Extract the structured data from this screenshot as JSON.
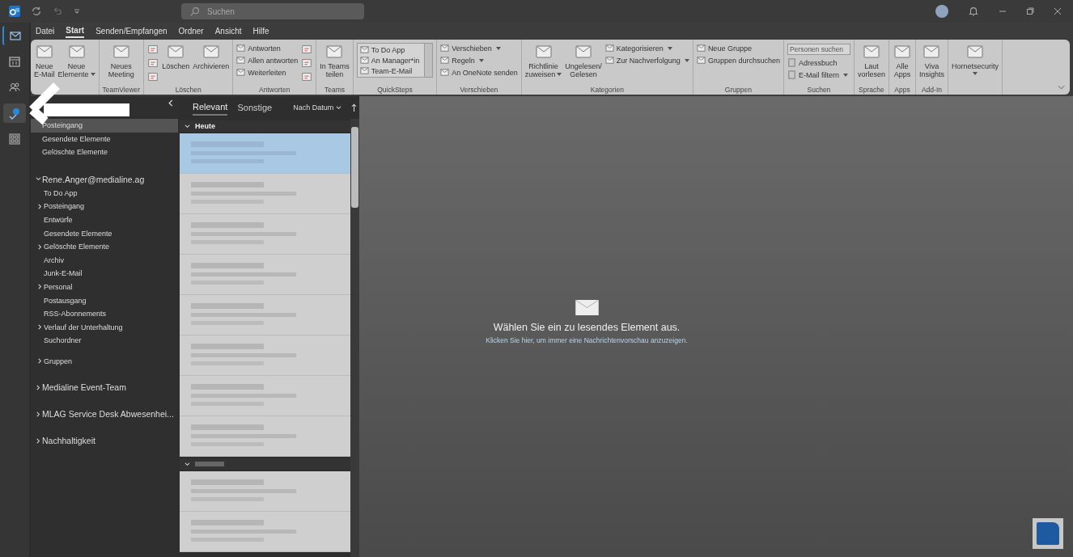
{
  "title_bar": {
    "search": {
      "placeholder": "Suchen"
    }
  },
  "menu_tabs": [
    {
      "label": "Datei",
      "selected": false
    },
    {
      "label": "Start",
      "selected": true
    },
    {
      "label": "Senden/Empfangen",
      "selected": false
    },
    {
      "label": "Ordner",
      "selected": false
    },
    {
      "label": "Ansicht",
      "selected": false
    },
    {
      "label": "Hilfe",
      "selected": false
    }
  ],
  "ribbon": [
    {
      "items": [
        {
          "kind": "large",
          "lines": [
            "Neue",
            "E-Mail"
          ],
          "dropdown": false
        },
        {
          "kind": "large",
          "lines": [
            "Neue",
            "Elemente"
          ],
          "dropdown": true
        }
      ]
    },
    {
      "name": "TeamViewer",
      "items": [
        {
          "kind": "large",
          "lines": [
            "Neues",
            "Meeting"
          ],
          "dropdown": false
        }
      ]
    },
    {
      "name": "Löschen",
      "items": [
        {
          "kind": "icons"
        },
        {
          "kind": "large",
          "lines": [
            "Löschen"
          ],
          "dropdown": false
        },
        {
          "kind": "large",
          "lines": [
            "Archivieren"
          ],
          "dropdown": false
        }
      ]
    },
    {
      "name": "Antworten",
      "items": [
        {
          "kind": "small",
          "entries": [
            {
              "label": "Antworten",
              "dropdown": false
            },
            {
              "label": "Allen antworten",
              "dropdown": false
            },
            {
              "label": "Weiterleiten",
              "dropdown": false
            }
          ]
        },
        {
          "kind": "icons"
        }
      ]
    },
    {
      "name": "Teams",
      "items": [
        {
          "kind": "large",
          "lines": [
            "In Teams",
            "teilen"
          ],
          "dropdown": false
        }
      ]
    },
    {
      "name": "QuickSteps",
      "items": [
        {
          "kind": "gallery",
          "entries": [
            "To Do App",
            "An Manager*in",
            "Team-E-Mail"
          ]
        }
      ]
    },
    {
      "name": "Verschieben",
      "items": [
        {
          "kind": "small",
          "entries": [
            {
              "label": "Verschieben",
              "dropdown": true
            },
            {
              "label": "Regeln",
              "dropdown": true
            },
            {
              "label": "An OneNote senden",
              "dropdown": false
            }
          ]
        }
      ]
    },
    {
      "name": "Kategorien",
      "items": [
        {
          "kind": "large",
          "lines": [
            "Richtlinie",
            "zuweisen"
          ],
          "dropdown": true
        },
        {
          "kind": "large",
          "lines": [
            "Ungelesen/",
            "Gelesen"
          ],
          "dropdown": false
        },
        {
          "kind": "small",
          "entries": [
            {
              "label": "Kategorisieren",
              "dropdown": true
            },
            {
              "label": "Zur Nachverfolgung",
              "dropdown": true
            }
          ]
        }
      ]
    },
    {
      "name": "Gruppen",
      "items": [
        {
          "kind": "small",
          "entries": [
            {
              "label": "Neue Gruppe",
              "dropdown": false
            },
            {
              "label": "Gruppen durchsuchen",
              "dropdown": false
            }
          ]
        }
      ]
    },
    {
      "name": "Suchen",
      "items": [
        {
          "kind": "search",
          "placeholder": "Personen suchen",
          "entries": [
            {
              "label": "Adressbuch",
              "dropdown": false
            },
            {
              "label": "E-Mail filtern",
              "dropdown": true
            }
          ]
        }
      ]
    },
    {
      "name": "Sprache",
      "items": [
        {
          "kind": "large",
          "lines": [
            "Laut",
            "vorlesen"
          ],
          "dropdown": false
        }
      ]
    },
    {
      "name": "Apps",
      "items": [
        {
          "kind": "large",
          "lines": [
            "Alle",
            "Apps"
          ],
          "dropdown": false
        }
      ]
    },
    {
      "name": "Add-In",
      "items": [
        {
          "kind": "large",
          "lines": [
            "Viva",
            "Insights"
          ],
          "dropdown": false
        }
      ]
    },
    {
      "items": [
        {
          "kind": "large",
          "lines": [
            "Hornetsecurity"
          ],
          "dropdown": true
        }
      ]
    }
  ],
  "favorites": [
    {
      "label": "Posteingang",
      "selected": true
    },
    {
      "label": "Gesendete Elemente",
      "selected": false
    },
    {
      "label": "Gelöschte Elemente",
      "selected": false
    }
  ],
  "accounts": [
    {
      "name": "Rene.Anger@medialine.ag",
      "expanded": true,
      "folders": [
        {
          "label": "To Do App",
          "expandable": false,
          "separated": false
        },
        {
          "label": "Posteingang",
          "expandable": true,
          "separated": false
        },
        {
          "label": "Entwürfe",
          "expandable": false,
          "separated": false
        },
        {
          "label": "Gesendete Elemente",
          "expandable": false,
          "separated": false
        },
        {
          "label": "Gelöschte Elemente",
          "expandable": true,
          "separated": false
        },
        {
          "label": "Archiv",
          "expandable": false,
          "separated": false
        },
        {
          "label": "Junk-E-Mail",
          "expandable": false,
          "separated": false
        },
        {
          "label": "Personal",
          "expandable": true,
          "separated": false
        },
        {
          "label": "Postausgang",
          "expandable": false,
          "separated": false
        },
        {
          "label": "RSS-Abonnements",
          "expandable": false,
          "separated": false
        },
        {
          "label": "Verlauf der Unterhaltung",
          "expandable": true,
          "separated": false
        },
        {
          "label": "Suchordner",
          "expandable": false,
          "separated": false
        },
        {
          "label": "Gruppen",
          "expandable": true,
          "separated": true
        }
      ]
    },
    {
      "name": "Medialine Event-Team",
      "expanded": false
    },
    {
      "name": "MLAG Service Desk Abwesenhei...",
      "expanded": false
    },
    {
      "name": "Nachhaltigkeit",
      "expanded": false
    }
  ],
  "message_list": {
    "tabs": [
      {
        "label": "Relevant",
        "selected": true
      },
      {
        "label": "Sonstige",
        "selected": false
      }
    ],
    "sort": "Nach Datum",
    "sections": [
      {
        "label": "Heute",
        "messages": [
          {
            "selected": true
          },
          {
            "selected": false
          },
          {
            "selected": false
          },
          {
            "selected": false
          },
          {
            "selected": false
          },
          {
            "selected": false
          },
          {
            "selected": false
          },
          {
            "selected": false
          }
        ]
      },
      {
        "messages": [
          {
            "selected": false
          },
          {
            "selected": false
          }
        ]
      }
    ]
  },
  "reading_pane": {
    "message": "Wählen Sie ein zu lesendes Element aus.",
    "link": "Klicken Sie hier, um immer eine Nachrichtenvorschau anzuzeigen."
  }
}
